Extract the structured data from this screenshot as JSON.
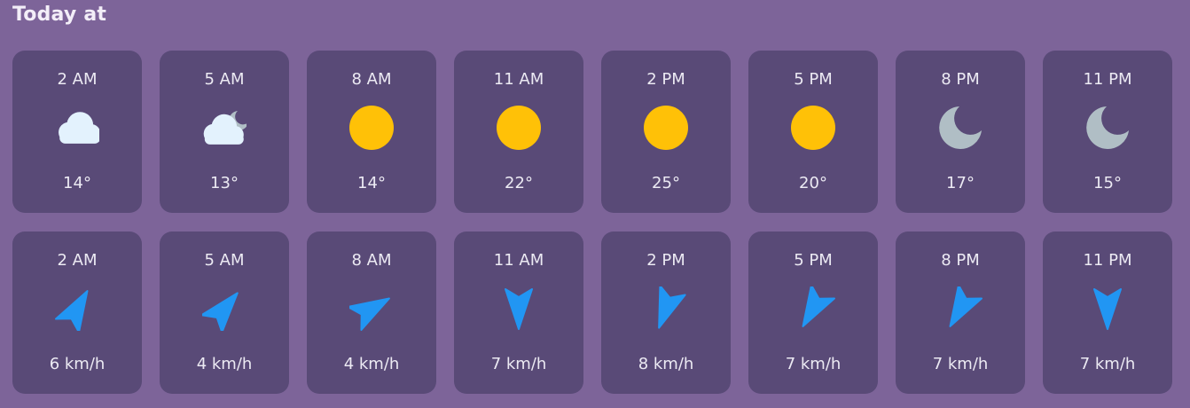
{
  "section_title": "Today at",
  "colors": {
    "background": "#7d6499",
    "card": "#594a77",
    "text": "#eceaf3",
    "sun": "#ffc107",
    "moon": "#b0bec5",
    "cloud": "#e3f2fd",
    "wind_arrow": "#2196f3"
  },
  "forecast": [
    {
      "time": "2 AM",
      "icon": "cloud-icon",
      "temp": "14°"
    },
    {
      "time": "5 AM",
      "icon": "cloud-moon-icon",
      "temp": "13°"
    },
    {
      "time": "8 AM",
      "icon": "sun-icon",
      "temp": "14°"
    },
    {
      "time": "11 AM",
      "icon": "sun-icon",
      "temp": "22°"
    },
    {
      "time": "2 PM",
      "icon": "sun-icon",
      "temp": "25°"
    },
    {
      "time": "5 PM",
      "icon": "sun-icon",
      "temp": "20°"
    },
    {
      "time": "8 PM",
      "icon": "moon-icon",
      "temp": "17°"
    },
    {
      "time": "11 PM",
      "icon": "moon-icon",
      "temp": "15°"
    }
  ],
  "wind": [
    {
      "time": "2 AM",
      "icon": "wind-direction-icon",
      "direction_deg": 30,
      "speed": "6 km/h"
    },
    {
      "time": "5 AM",
      "icon": "wind-direction-icon",
      "direction_deg": 40,
      "speed": "4 km/h"
    },
    {
      "time": "8 AM",
      "icon": "wind-direction-icon",
      "direction_deg": 60,
      "speed": "4 km/h"
    },
    {
      "time": "11 AM",
      "icon": "wind-direction-icon",
      "direction_deg": 180,
      "speed": "7 km/h"
    },
    {
      "time": "2 PM",
      "icon": "wind-direction-icon",
      "direction_deg": 200,
      "speed": "8 km/h"
    },
    {
      "time": "5 PM",
      "icon": "wind-direction-icon",
      "direction_deg": 210,
      "speed": "7 km/h"
    },
    {
      "time": "8 PM",
      "icon": "wind-direction-icon",
      "direction_deg": 210,
      "speed": "7 km/h"
    },
    {
      "time": "11 PM",
      "icon": "wind-direction-icon",
      "direction_deg": 180,
      "speed": "7 km/h"
    }
  ]
}
